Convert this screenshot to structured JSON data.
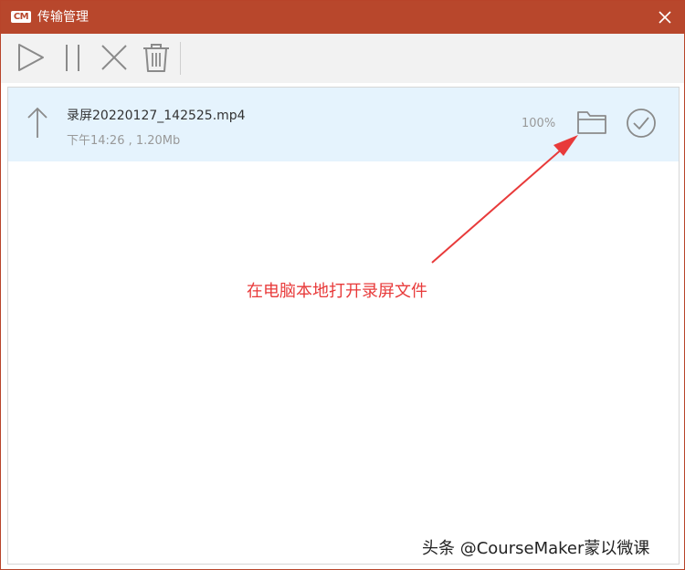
{
  "window": {
    "logo": "CM",
    "title": "传输管理"
  },
  "toolbar": {
    "buttons": [
      {
        "name": "start",
        "icon": "play-icon"
      },
      {
        "name": "pause",
        "icon": "pause-icon"
      },
      {
        "name": "cancel",
        "icon": "close-icon"
      },
      {
        "name": "delete",
        "icon": "trash-icon"
      }
    ]
  },
  "transfers": [
    {
      "direction_icon": "upload-arrow-icon",
      "filename": "录屏20220127_142525.mp4",
      "info": "下午14:26 , 1.20Mb",
      "progress_text": "100%",
      "progress": 1.0,
      "folder_icon": "folder-icon",
      "status_icon": "check-circle-icon"
    }
  ],
  "annotation": {
    "text": "在电脑本地打开录屏文件",
    "color": "#e83a3a"
  },
  "watermark": "头条 @CourseMaker蒙以微课",
  "colors": {
    "titlebar": "#b8472c",
    "selected_row": "#e5f3fd",
    "toolbar_bg": "#f2f2f2",
    "icon_gray": "#8a8a8a"
  }
}
